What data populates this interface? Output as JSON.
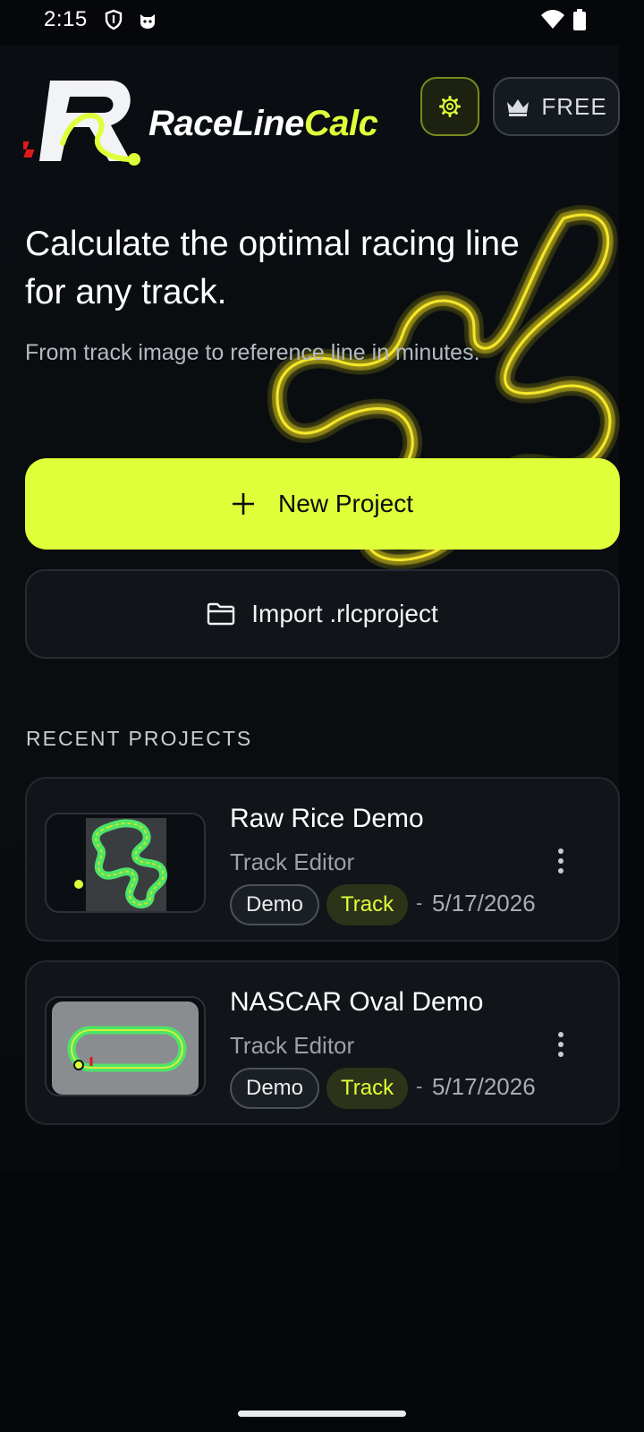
{
  "status_bar": {
    "time": "2:15",
    "icons": [
      "shield-icon",
      "cat-icon",
      "wifi-icon",
      "battery-icon"
    ]
  },
  "header": {
    "brand_part1": "RaceLine",
    "brand_part2": "Calc",
    "settings_icon": "gear-icon",
    "plan_icon": "crown-icon",
    "plan_label": "FREE"
  },
  "hero": {
    "title": "Calculate the optimal racing line for any track.",
    "subtitle": "From track image to reference line in minutes."
  },
  "actions": {
    "new_project_label": "New Project",
    "new_project_icon": "plus-icon",
    "import_label": "Import .rlcproject",
    "import_icon": "folder-icon"
  },
  "recent": {
    "section_label": "RECENT PROJECTS",
    "projects": [
      {
        "title": "Raw Rice Demo",
        "subtitle": "Track Editor",
        "badge_demo": "Demo",
        "badge_track": "Track",
        "separator": "-",
        "date": "5/17/2026"
      },
      {
        "title": "NASCAR Oval Demo",
        "subtitle": "Track Editor",
        "badge_demo": "Demo",
        "badge_track": "Track",
        "separator": "-",
        "date": "5/17/2026"
      }
    ]
  },
  "colors": {
    "accent": "#dfff3a",
    "background": "#05070a",
    "card": "#111519"
  }
}
